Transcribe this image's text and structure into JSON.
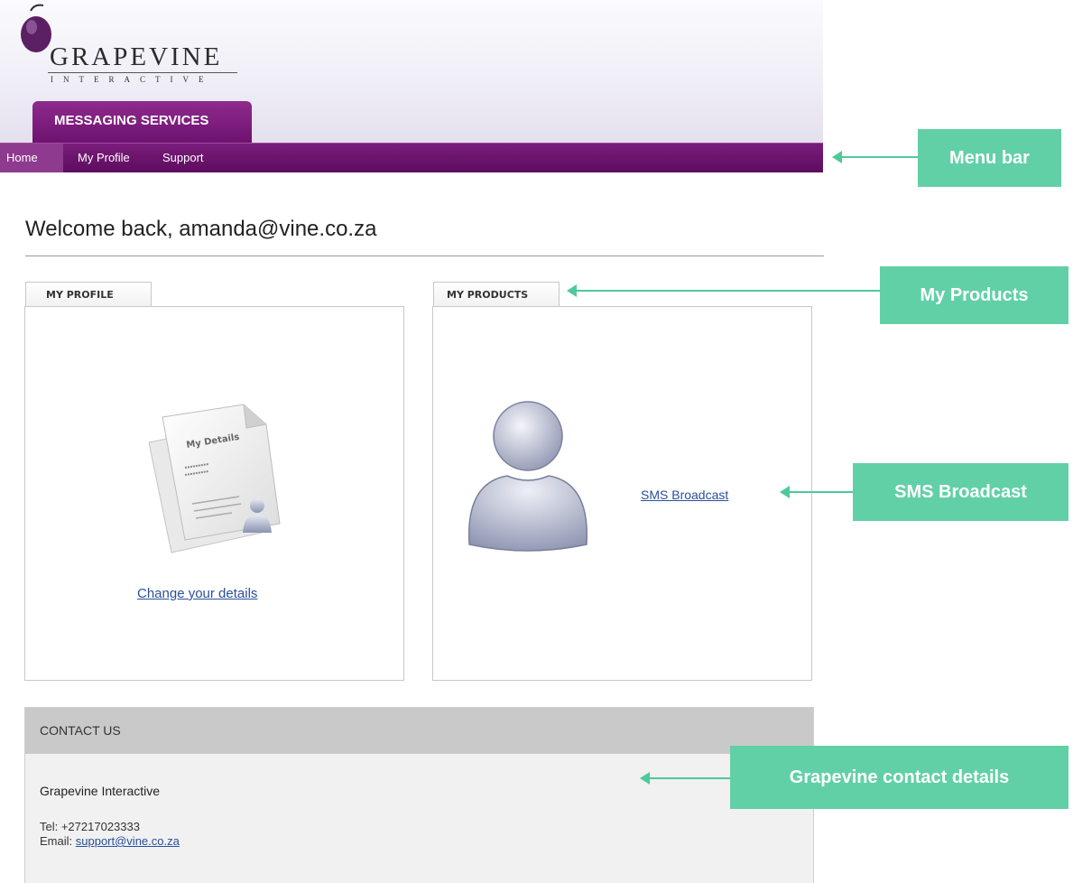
{
  "header": {
    "logo_name": "GRAPEVINE",
    "logo_subtitle": "INTERACTIVE",
    "product_tab": "MESSAGING SERVICES"
  },
  "menu": {
    "items": [
      {
        "label": "Home",
        "active": true
      },
      {
        "label": "My Profile",
        "active": false
      },
      {
        "label": "Support",
        "active": false
      }
    ]
  },
  "welcome": "Welcome back, amanda@vine.co.za",
  "profile_panel": {
    "tab_label": "MY PROFILE",
    "icon": "my-details-document-icon",
    "icon_caption": "My Details",
    "link": "Change your details"
  },
  "products_panel": {
    "tab_label": "MY PRODUCTS",
    "icon": "user-silhouette-icon",
    "link": "SMS Broadcast"
  },
  "contact": {
    "heading": "CONTACT US",
    "company": "Grapevine Interactive",
    "tel": "Tel: +27217023333",
    "email_label": "Email:",
    "email": "support@vine.co.za"
  },
  "annotations": {
    "menu_bar": "Menu bar",
    "my_products": "My Products",
    "sms_broadcast": "SMS Broadcast",
    "contact_details": "Grapevine contact details"
  },
  "colors": {
    "brand_purple": "#6e126f",
    "annotation_green": "#62d0a6",
    "link_blue": "#2a4f9b"
  }
}
